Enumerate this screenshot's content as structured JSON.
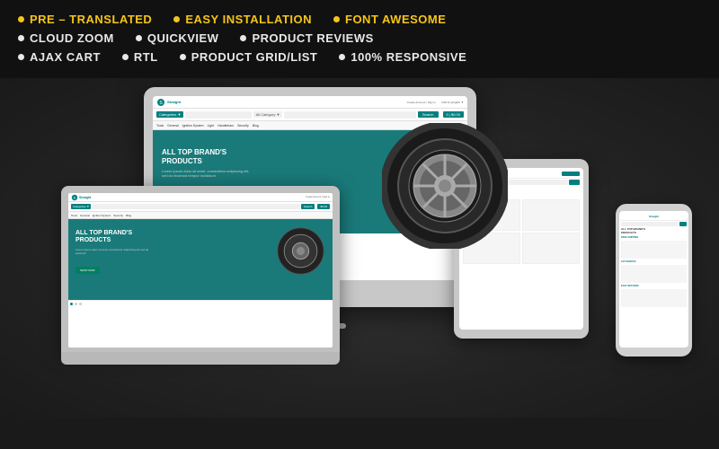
{
  "features": {
    "rows": [
      {
        "items": [
          {
            "text": "PRE – TRANSLATED",
            "style": "yellow"
          },
          {
            "text": "EASY INSTALLATION",
            "style": "yellow"
          },
          {
            "text": "FONT AWESOME",
            "style": "yellow"
          }
        ]
      },
      {
        "items": [
          {
            "text": "CLOUD ZOOM",
            "style": "normal"
          },
          {
            "text": "QUICKVIEW",
            "style": "normal"
          },
          {
            "text": "PRODUCT REVIEWS",
            "style": "normal"
          }
        ]
      },
      {
        "items": [
          {
            "text": "AJAX CART",
            "style": "normal"
          },
          {
            "text": "RTL",
            "style": "normal"
          },
          {
            "text": "PRODUCT GRID/LIST",
            "style": "normal"
          },
          {
            "text": "100% RESPONSIVE",
            "style": "normal"
          }
        ]
      }
    ]
  },
  "preview": {
    "brand": "Straight",
    "tagline": "ALL TOP BRAND'S PRODUCTS",
    "sub_tagline": "ALL TOP BRAND'S PRODUCTS",
    "free_shipping": "FREE SHIPPING",
    "service": "24/7 SERVICE",
    "easy_returns": "EASY RETURNS"
  },
  "colors": {
    "accent": "#008080",
    "yellow": "#f5c518",
    "bg_dark": "#111111",
    "bg_preview": "#2a2a2a",
    "device_chrome": "#c8c8c8"
  }
}
